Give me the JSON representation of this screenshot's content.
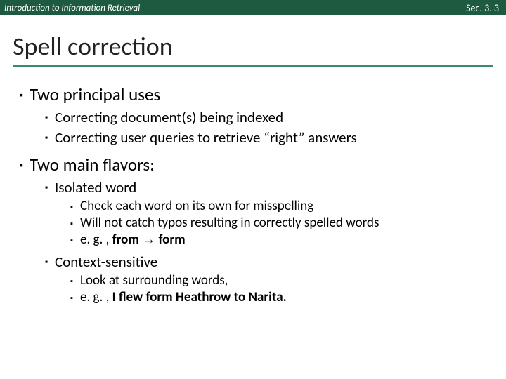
{
  "header": {
    "left": "Introduction to Information Retrieval",
    "right": "Sec. 3. 3"
  },
  "title": "Spell correction",
  "bullets": {
    "uses": "Two principal uses",
    "uses1": "Correcting document(s) being indexed",
    "uses2": "Correcting user queries to retrieve “right” answers",
    "flavors": "Two main flavors:",
    "iso": "Isolated word",
    "iso1": "Check each word on its own for misspelling",
    "iso2": "Will not catch typos resulting in correctly spelled words",
    "iso3_pre": "e. g. , ",
    "iso3_from": "from",
    "iso3_form": "form",
    "ctx": "Context-sensitive",
    "ctx1": "Look at surrounding words,",
    "ctx2_pre": "e. g. , ",
    "ctx2_bold1": "I flew ",
    "ctx2_u": "form",
    "ctx2_bold2": " Heathrow to Narita."
  }
}
